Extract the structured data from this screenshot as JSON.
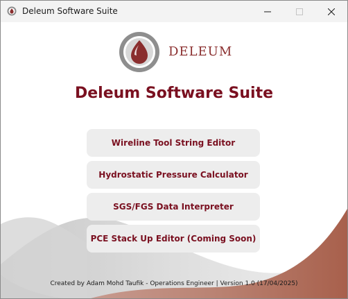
{
  "window": {
    "title": "Deleum Software Suite",
    "minimize_icon": "minimize-icon",
    "maximize_icon": "maximize-icon",
    "close_icon": "close-icon"
  },
  "logo": {
    "text": "DELEUM",
    "icon": "deleum-drop-logo"
  },
  "main": {
    "title": "Deleum Software Suite",
    "buttons": [
      {
        "label": "Wireline Tool String Editor"
      },
      {
        "label": "Hydrostatic Pressure Calculator"
      },
      {
        "label": "SGS/FGS Data Interpreter"
      },
      {
        "label": "PCE Stack Up Editor (Coming Soon)"
      }
    ]
  },
  "footer": {
    "text": "Created by Adam Mohd Taufik - Operations Engineer  |  Version 1.0 (17/04/2025)"
  },
  "colors": {
    "accent": "#7a1020",
    "wave_dark": "#b06a5a",
    "wave_light": "#d9d9d9",
    "button_bg": "#ededed"
  }
}
